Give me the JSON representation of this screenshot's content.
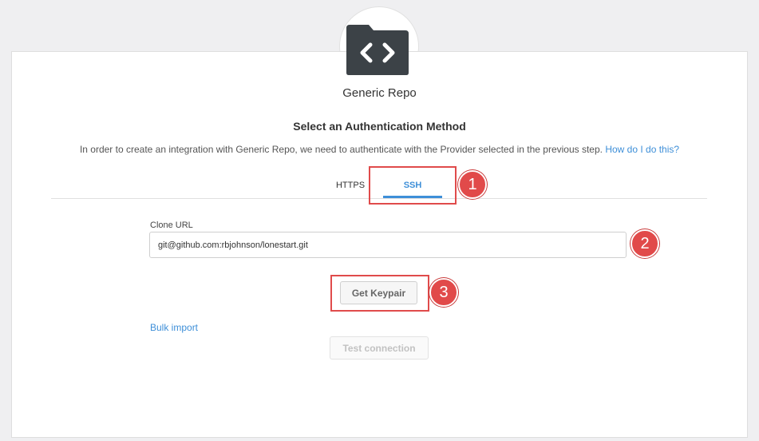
{
  "provider": {
    "name": "Generic Repo",
    "logo_icon": "folder-code-icon",
    "logo_color": "#3c4247"
  },
  "auth": {
    "title": "Select an Authentication Method",
    "info_text": "In order to create an integration with Generic Repo, we need to authenticate with the Provider selected in the previous step.",
    "help_link": "How do I do this?"
  },
  "tabs": [
    {
      "label": "HTTPS",
      "active": false
    },
    {
      "label": "SSH",
      "active": true
    }
  ],
  "form": {
    "clone_url_label": "Clone URL",
    "clone_url_value": "git@github.com:rbjohnson/lonestart.git",
    "get_keypair_label": "Get Keypair",
    "bulk_import_label": "Bulk import",
    "test_connection_label": "Test connection"
  },
  "annotations": {
    "markers": [
      "1",
      "2",
      "3"
    ],
    "color": "#e14a4a"
  },
  "colors": {
    "accent": "#3e8fd8",
    "background": "#efeff1"
  }
}
